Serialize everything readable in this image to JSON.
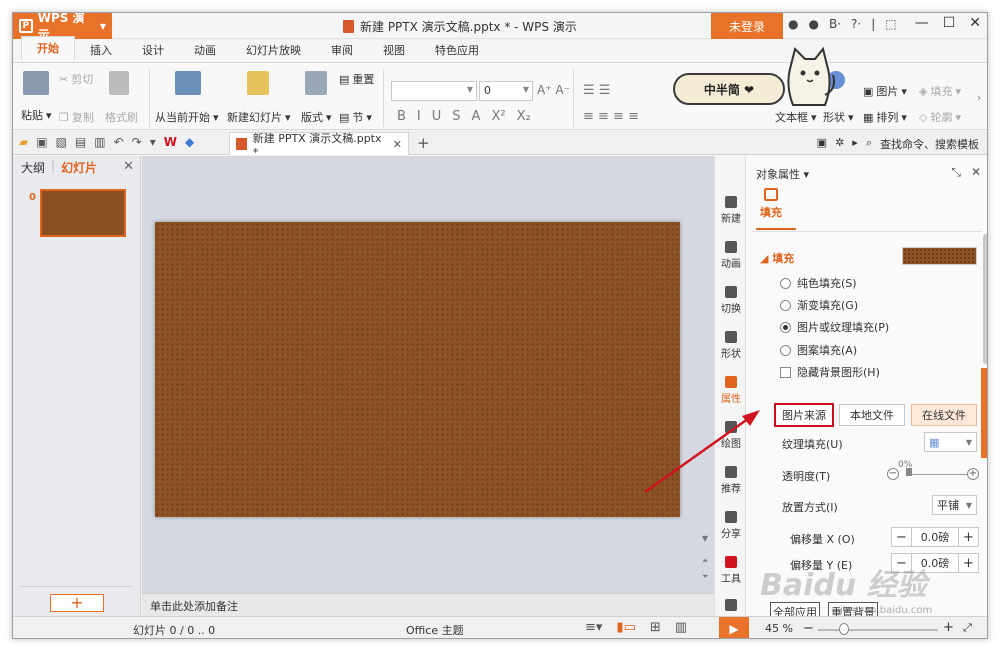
{
  "app": {
    "menu_label": "WPS 演示",
    "logo_glyph": "P",
    "window_title": "新建 PPTX 演示文稿.pptx * - WPS 演示",
    "login_label": "未登录",
    "title_icons": [
      "●",
      "●",
      "B·",
      "?·",
      "|",
      "⬚"
    ],
    "win_controls": [
      "—",
      "☐",
      "✕"
    ]
  },
  "tabs": [
    "开始",
    "插入",
    "设计",
    "动画",
    "幻灯片放映",
    "审阅",
    "视图",
    "特色应用"
  ],
  "ribbon": {
    "paste": "粘贴",
    "cut": "剪切",
    "copy": "复制",
    "format_painter": "格式刷",
    "from_current": "从当前开始",
    "new_slide": "新建幻灯片",
    "layout": "版式",
    "reset": "重置",
    "section": "节",
    "font_size": "0",
    "textbox": "文本框",
    "shape": "形状",
    "picture": "图片",
    "arrange": "排列",
    "fill": "填充",
    "outline": "轮廓",
    "format_glyphs": [
      "B",
      "I",
      "U",
      "S",
      "A",
      "X²",
      "X₂"
    ]
  },
  "sticker": {
    "text": "中半简 ❤"
  },
  "qbar": {
    "doc_tab": "新建 PPTX 演示文稿.pptx *",
    "add_tab": "+",
    "search": "查找命令、搜索模板"
  },
  "left_panel": {
    "tab_outline": "大纲",
    "tab_slides": "幻灯片",
    "slide_number": "0",
    "add_button": "+"
  },
  "notes_placeholder": "单击此处添加备注",
  "right_toolbar": [
    {
      "label": "新建",
      "active": false
    },
    {
      "label": "动画",
      "active": false
    },
    {
      "label": "切换",
      "active": false
    },
    {
      "label": "形状",
      "active": false
    },
    {
      "label": "属性",
      "active": true
    },
    {
      "label": "绘图",
      "active": false
    },
    {
      "label": "推荐",
      "active": false
    },
    {
      "label": "分享",
      "active": false
    },
    {
      "label": "工具",
      "active": false
    },
    {
      "label": "备份",
      "active": false
    }
  ],
  "property_panel": {
    "title": "对象属性 ▾",
    "fill_tab": "填充",
    "section_title": "◢ 填充",
    "options": [
      {
        "label": "纯色填充(S)",
        "type": "radio",
        "selected": false
      },
      {
        "label": "渐变填充(G)",
        "type": "radio",
        "selected": false
      },
      {
        "label": "图片或纹理填充(P)",
        "type": "radio",
        "selected": true
      },
      {
        "label": "图案填充(A)",
        "type": "radio",
        "selected": false
      },
      {
        "label": "隐藏背景图形(H)",
        "type": "check",
        "selected": false
      }
    ],
    "source_label": "图片来源",
    "local_file": "本地文件",
    "online_file": "在线文件",
    "texture_label": "纹理填充(U)",
    "transparency_label": "透明度(T)",
    "transparency_value": "0%",
    "placement_label": "放置方式(I)",
    "placement_value": "平铺",
    "offset_x_label": "偏移量 X (O)",
    "offset_x_value": "0.0磅",
    "offset_y_label": "偏移量 Y (E)",
    "offset_y_value": "0.0磅",
    "apply_all": "全部应用",
    "reset_bg": "重置背景"
  },
  "status": {
    "slide_info": "幻灯片 0 / 0 .. 0",
    "theme": "Office 主题",
    "zoom": "45 %"
  },
  "watermark": {
    "text": "Baidu 经验",
    "url": "jingyan.baidu.com"
  },
  "colors": {
    "accent": "#e8722a",
    "highlight_box": "#c8101e",
    "arrow": "#d0121e",
    "slide_bg": "#8d5226"
  }
}
